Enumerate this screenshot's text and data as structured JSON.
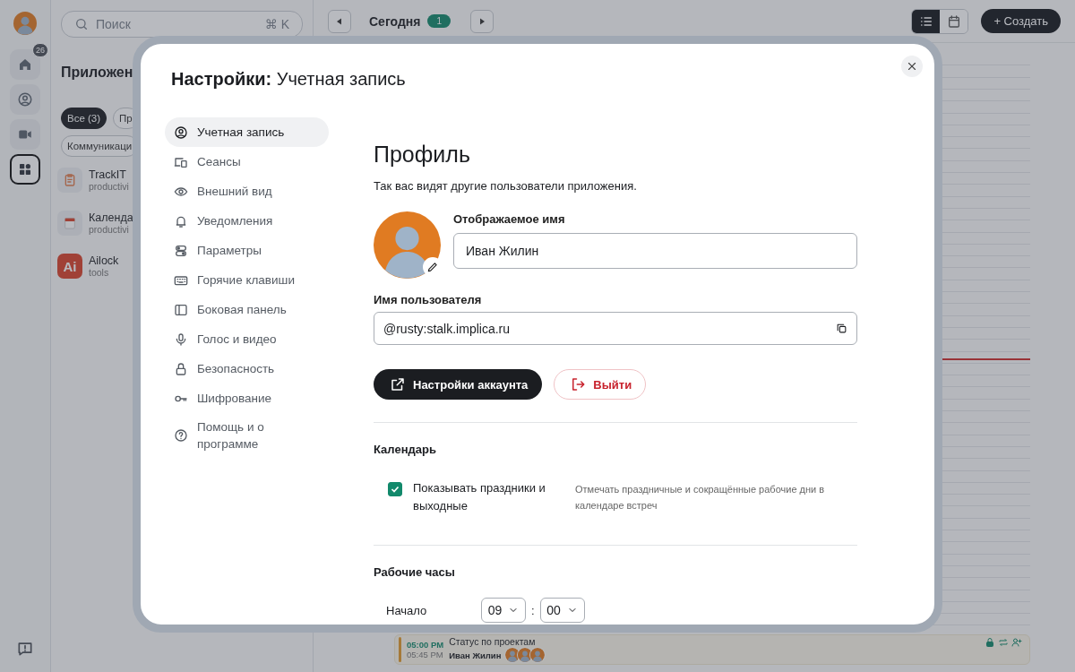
{
  "rail": {
    "user": {
      "kind": "avatar"
    },
    "items": [
      {
        "kind": "home",
        "badge": "26",
        "selected": false
      },
      {
        "kind": "contacts",
        "selected": false
      },
      {
        "kind": "video",
        "selected": false
      },
      {
        "kind": "apps",
        "selected": true
      }
    ],
    "bottom": {
      "kind": "feedback"
    }
  },
  "apps_panel": {
    "search": {
      "placeholder": "Поиск",
      "shortcut": "⌘ K"
    },
    "title": "Приложен",
    "filters": [
      {
        "label": "Все (3)",
        "selected": true
      },
      {
        "label": "Пр",
        "selected": false
      },
      {
        "label": "Коммуникаци",
        "selected": false
      }
    ],
    "apps": [
      {
        "kind": "clipboard",
        "name": "TrackIT",
        "category": "productivi"
      },
      {
        "kind": "calendar",
        "name": "Календа",
        "category": "productivi"
      },
      {
        "kind": "logo",
        "logo_text": "Ai",
        "name": "Ailock",
        "category": "tools"
      }
    ]
  },
  "toolbar": {
    "today": "Сегодня",
    "count": "1",
    "views": [
      {
        "kind": "list",
        "selected": true
      },
      {
        "kind": "calendar",
        "selected": false
      }
    ],
    "create": "+ Создать"
  },
  "event": {
    "start": "05:00 PM",
    "end": "05:45 PM",
    "title": "Статус по проектам",
    "organizer": "Иван Жилин",
    "participants": [
      {
        "kind": "avatar"
      },
      {
        "kind": "avatar"
      },
      {
        "kind": "avatar"
      }
    ],
    "flags": [
      {
        "kind": "lock"
      },
      {
        "kind": "repeat"
      },
      {
        "kind": "invite"
      }
    ]
  },
  "settings": {
    "title": "**Настройки:** Учетная запись",
    "nav": [
      {
        "kind": "account",
        "label": "Учетная запись",
        "selected": true
      },
      {
        "kind": "sessions",
        "label": "Сеансы",
        "selected": false
      },
      {
        "kind": "appearance",
        "label": "Внешний вид",
        "selected": false
      },
      {
        "kind": "notifications",
        "label": "Уведомления",
        "selected": false
      },
      {
        "kind": "preferences",
        "label": "Параметры",
        "selected": false
      },
      {
        "kind": "shortcuts",
        "label": "Горячие клавиши",
        "selected": false
      },
      {
        "kind": "sidebar",
        "label": "Боковая панель",
        "selected": false
      },
      {
        "kind": "voice",
        "label": "Голос и видео",
        "selected": false
      },
      {
        "kind": "security",
        "label": "Безопасность",
        "selected": false
      },
      {
        "kind": "encryption",
        "label": "Шифрование",
        "selected": false
      },
      {
        "kind": "help",
        "label": "Помощь и о программе",
        "selected": false
      }
    ],
    "profile": {
      "heading": "Профиль",
      "description": "Так вас видят другие пользователи приложения.",
      "avatar": {
        "kind": "avatar"
      },
      "display_name": {
        "label": "Отображаемое имя",
        "value": "Иван Жилин"
      },
      "username": {
        "label": "Имя пользователя",
        "value": "@rusty:stalk.implica.ru"
      },
      "buttons": [
        {
          "kind": "primary",
          "label": "Настройки аккаунта"
        },
        {
          "kind": "danger",
          "label": "Выйти"
        }
      ]
    },
    "calendar": {
      "heading": "Календарь",
      "options": [
        {
          "label": "Показывать праздники и выходные",
          "hint": "Отмечать праздничные и сокращённые рабочие дни в календаре встреч",
          "checked": true
        }
      ]
    },
    "work_hours": {
      "heading": "Рабочие часы",
      "start": {
        "label": "Начало",
        "hour": "09",
        "separator": ":",
        "minute": "00"
      }
    }
  }
}
